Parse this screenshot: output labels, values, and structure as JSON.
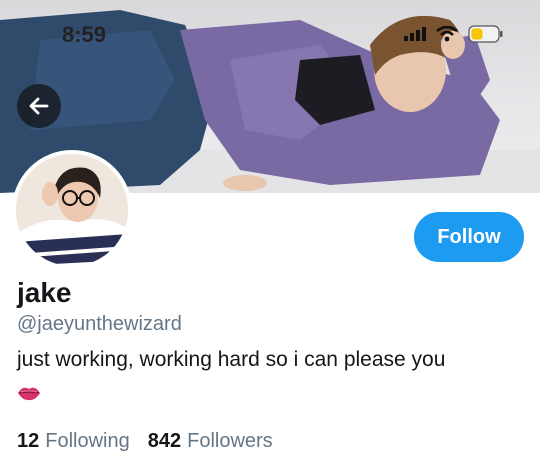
{
  "status_bar": {
    "time": "8:59"
  },
  "profile": {
    "name": "jake",
    "handle": "@jaeyunthewizard",
    "bio": "just working, working hard so i can please you",
    "bio_emoji": "lips-emoji"
  },
  "actions": {
    "follow_label": "Follow"
  },
  "stats": {
    "following_count": "12",
    "following_label": "Following",
    "followers_count": "842",
    "followers_label": "Followers"
  },
  "colors": {
    "accent": "#1d9bf0",
    "secondary_text": "#657786",
    "primary_text": "#14171a",
    "battery": "#f7c600"
  },
  "icons": [
    "back-arrow-icon",
    "signal-icon",
    "wifi-icon",
    "battery-icon"
  ]
}
